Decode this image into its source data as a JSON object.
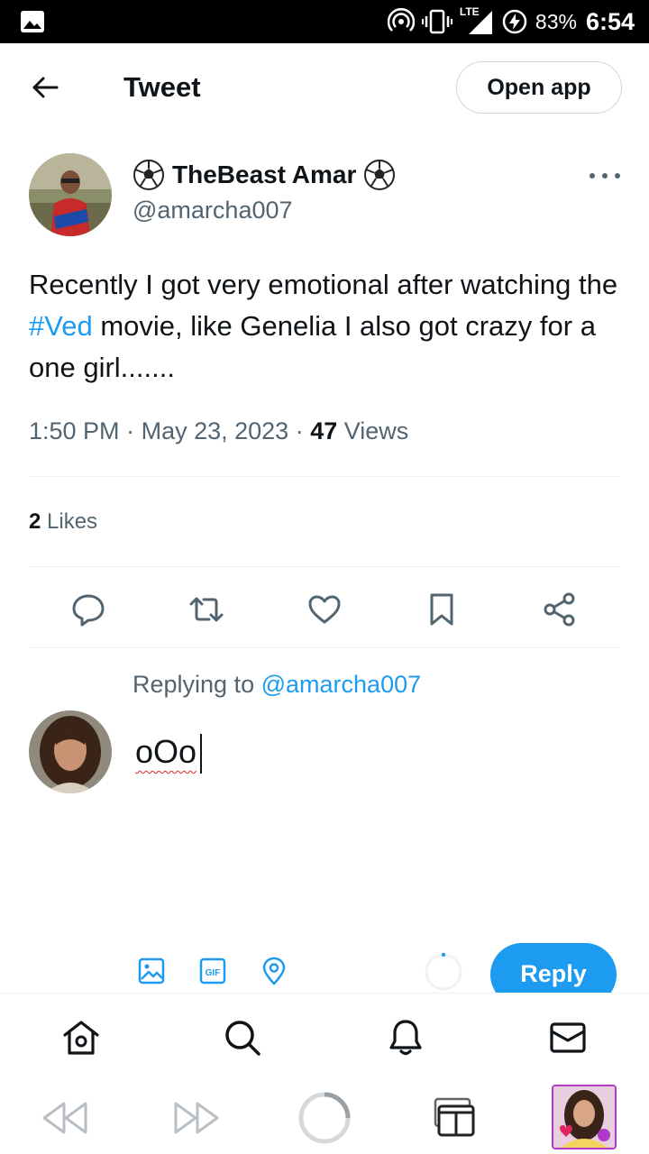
{
  "status_bar": {
    "battery": "83%",
    "time": "6:54",
    "network": "LTE",
    "icons": [
      "gallery-icon",
      "hotspot-icon",
      "vibrate-icon",
      "signal-icon",
      "battery-charging-icon"
    ]
  },
  "header": {
    "title": "Tweet",
    "open_app_label": "Open app"
  },
  "tweet": {
    "author_name": "TheBeast Amar",
    "author_emoji": "⚽",
    "author_handle": "@amarcha007",
    "text_before": "Recently I got very emotional after watching the ",
    "hashtag": "#Ved",
    "text_after": " movie, like Genelia I also got crazy for a one girl.......",
    "time": "1:50 PM",
    "date": "May 23, 2023",
    "views_count": "47",
    "views_label": "Views",
    "likes_count": "2",
    "likes_label": "Likes"
  },
  "reply": {
    "replying_to_label": "Replying to",
    "replying_to_handle": "@amarcha007",
    "typed_text": "oOo",
    "button_label": "Reply"
  },
  "colors": {
    "accent": "#1d9bf0",
    "text_primary": "#0f1419",
    "text_secondary": "#536471",
    "divider": "#eff3f4"
  }
}
